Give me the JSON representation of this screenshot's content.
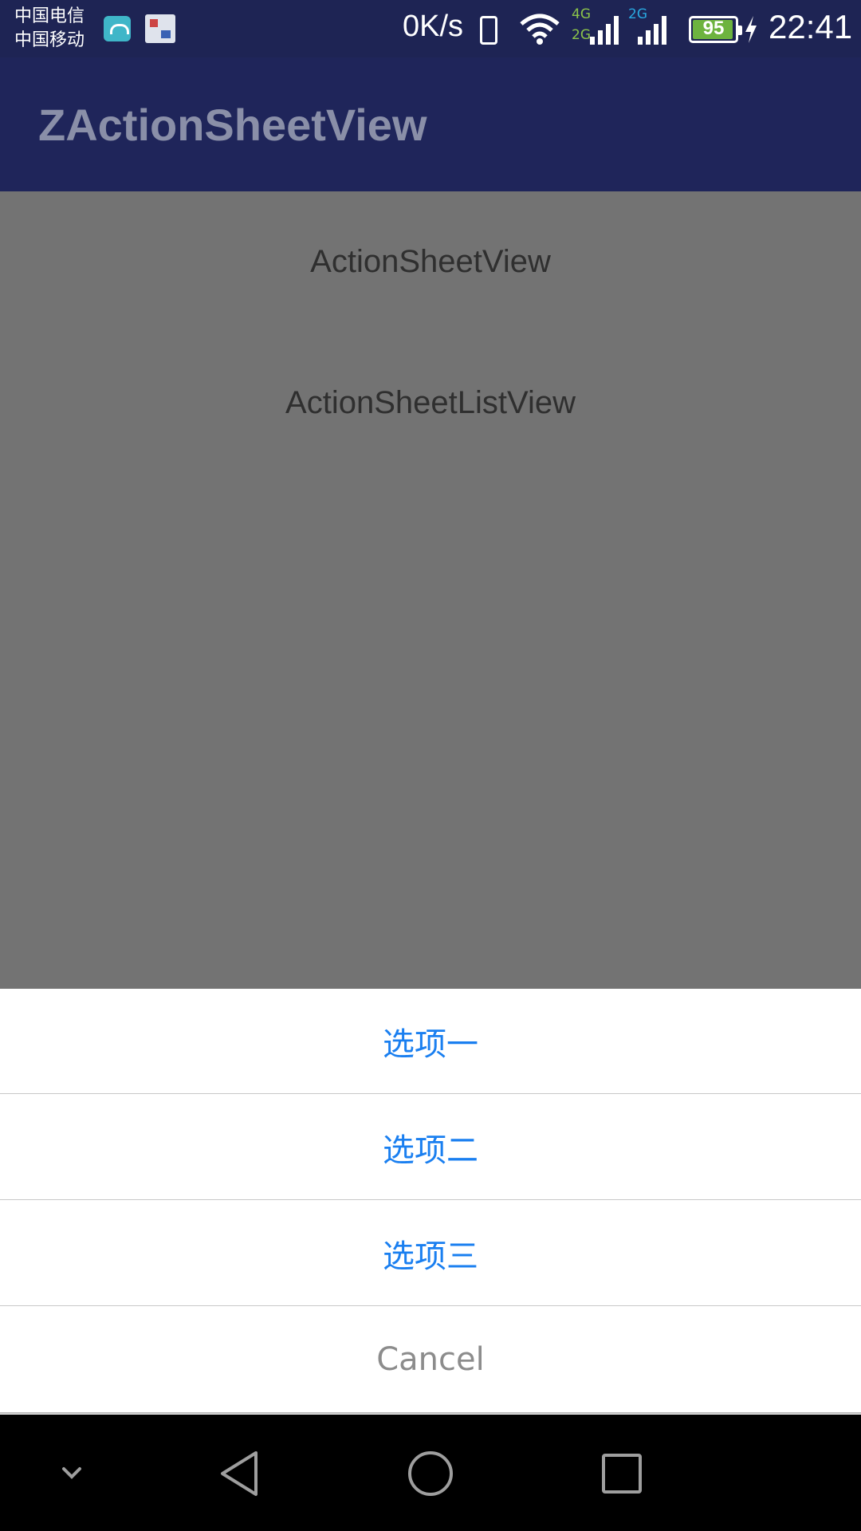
{
  "status_bar": {
    "carrier_1": "中国电信",
    "carrier_2": "中国移动",
    "net_speed": "0K/s",
    "network_4g": "4G",
    "network_2g_1": "2G",
    "network_2g_2": "2G",
    "battery_level": "95",
    "time": "22:41",
    "colors": {
      "background": "#1e2454",
      "battery_fill": "#6db33f",
      "label_4g": "#8bc34a",
      "label_2g": "#29a8e0"
    },
    "icons": [
      "android-app-icon",
      "gallery-app-icon",
      "vibrate-icon",
      "wifi-icon",
      "signal-icon",
      "battery-icon",
      "charging-icon"
    ]
  },
  "app_bar": {
    "title": "ZActionSheetView",
    "color": "#1f255a"
  },
  "content": {
    "links": [
      "ActionSheetView",
      "ActionSheetListView"
    ],
    "overlay_color": "#737373"
  },
  "action_sheet": {
    "options": [
      "选项一",
      "选项二",
      "选项三"
    ],
    "cancel_label": "Cancel",
    "option_color": "#1a7ff0",
    "cancel_color": "#8c8c8c"
  },
  "nav_bar": {
    "icons": [
      "chevron-down-icon",
      "back-icon",
      "home-icon",
      "recents-icon"
    ]
  }
}
